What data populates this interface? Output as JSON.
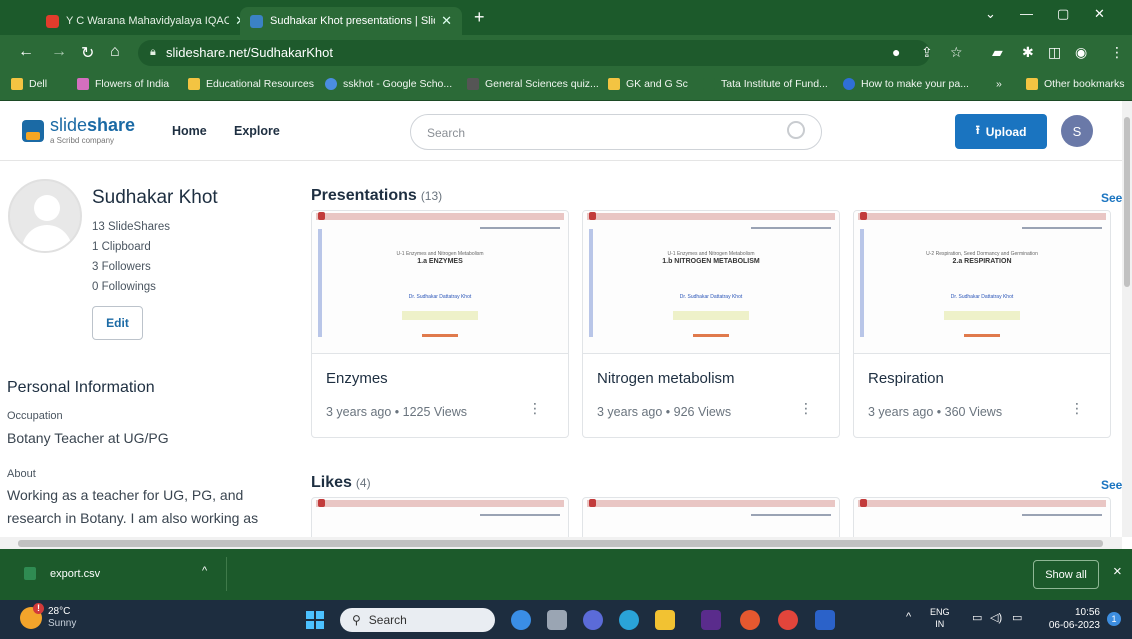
{
  "browser": {
    "tabs": [
      {
        "title": "Y C Warana Mahavidyalaya IQAC - Y",
        "favicon_color": "#e23c2c"
      },
      {
        "title": "Sudhakar Khot presentations | Slide",
        "favicon_color": "#3b82c4"
      }
    ],
    "url": "slideshare.net/SudhakarKhot",
    "bookmarks": [
      {
        "label": "Dell",
        "color": "#f3c442"
      },
      {
        "label": "Flowers of India",
        "color": "#d46fbf"
      },
      {
        "label": "Educational Resources",
        "color": "#f3c442"
      },
      {
        "label": "sskhot - Google Scho...",
        "color": "#4b8de0"
      },
      {
        "label": "General Sciences quiz...",
        "color": "#555"
      },
      {
        "label": "GK and G Sc",
        "color": "#f3c442"
      },
      {
        "label": "Tata Institute of Fund...",
        "color": "#888"
      },
      {
        "label": "How to make your pa...",
        "color": "#2f6fd6"
      }
    ],
    "bookmarks_more": "»",
    "other_bookmarks": "Other bookmarks"
  },
  "site": {
    "logo_main_1": "slide",
    "logo_main_2": "share",
    "logo_sub": "a Scribd company",
    "nav": [
      "Home",
      "Explore"
    ],
    "search_placeholder": "Search",
    "upload_label": "Upload",
    "avatar_letter": "S"
  },
  "profile": {
    "name": "Sudhakar Khot",
    "stats": [
      "13 SlideShares",
      "1 Clipboard",
      "3 Followers",
      "0 Followings"
    ],
    "edit_label": "Edit",
    "personal_info_heading": "Personal Information",
    "occupation_label": "Occupation",
    "occupation_value": "Botany Teacher at UG/PG",
    "about_label": "About",
    "about_line1": "Working as a teacher for UG, PG, and",
    "about_line2": "research in Botany. I am also working as"
  },
  "presentations": {
    "heading": "Presentations",
    "count": "(13)",
    "see_all": "See",
    "items": [
      {
        "title": "Enzymes",
        "meta": "3 years ago • 1225 Views",
        "slide_title": "1.a ENZYMES",
        "slide_chapter": "U-1 Enzymes and Nitrogen Metabolism"
      },
      {
        "title": "Nitrogen metabolism",
        "meta": "3 years ago • 926 Views",
        "slide_title": "1.b NITROGEN METABOLISM",
        "slide_chapter": "U-1 Enzymes and Nitrogen Metabolism"
      },
      {
        "title": "Respiration",
        "meta": "3 years ago • 360 Views",
        "slide_title": "2.a RESPIRATION",
        "slide_chapter": "U-2 Respiration, Seed Dormancy and Germination"
      }
    ],
    "slide_author": "Dr. Sudhakar Dattatray Khot"
  },
  "likes": {
    "heading": "Likes",
    "count": "(4)",
    "see_all": "See"
  },
  "downloads": {
    "file": "export.csv",
    "chevron": "^",
    "show_all": "Show all",
    "close": "×"
  },
  "taskbar": {
    "temp": "28°C",
    "weather": "Sunny",
    "search": "Search",
    "lang1": "ENG",
    "lang2": "IN",
    "time": "10:56",
    "date": "06-06-2023",
    "notif": "1"
  }
}
